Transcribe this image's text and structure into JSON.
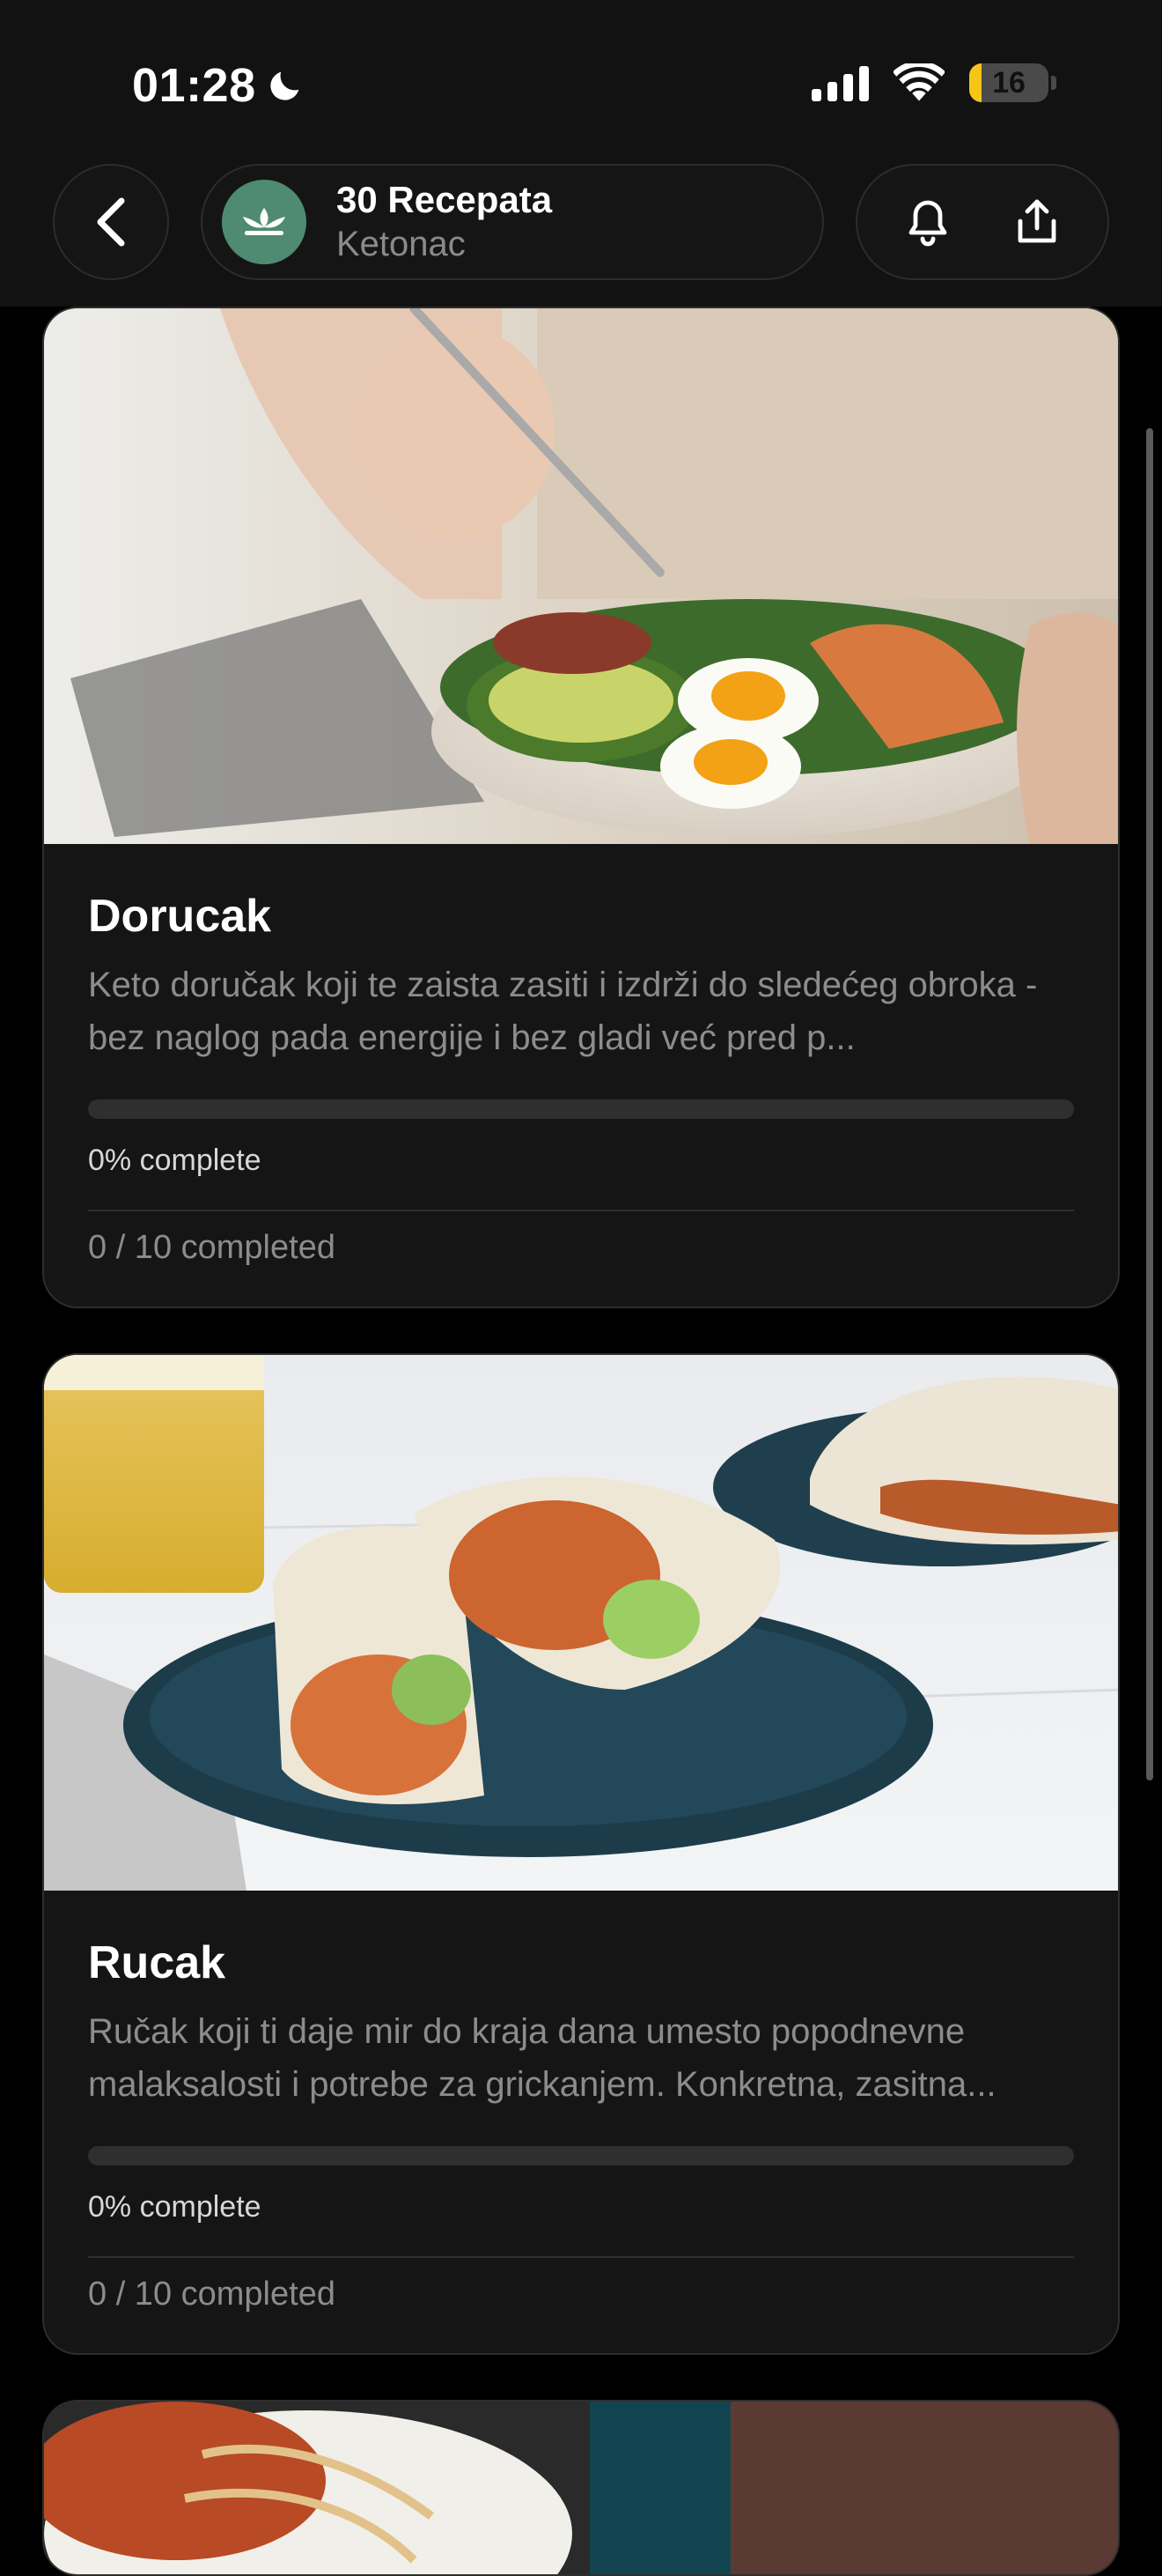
{
  "status_bar": {
    "time": "01:28",
    "battery_level": "16",
    "icons": [
      "moon-icon",
      "signal-icon",
      "wifi-icon",
      "battery-icon"
    ]
  },
  "header": {
    "title": "30 Recepata",
    "subtitle": "Ketonac",
    "back_icon": "chevron-left-icon",
    "avatar_icon": "lotus-icon",
    "actions": [
      "bell-icon",
      "share-icon"
    ],
    "accent_color": "#4f8a73"
  },
  "cards": [
    {
      "title": "Dorucak",
      "description": "Keto doručak koji te zaista zasiti i izdrži do sledećeg obroka - bez naglog pada energije i bez gladi već pred p...",
      "progress_percent": 0,
      "progress_label": "0% complete",
      "completed_label": "0 / 10 completed"
    },
    {
      "title": "Rucak",
      "description": "Ručak koji ti daje mir do kraja dana umesto popodnevne malaksalosti i potrebe za grickanjem. Konkretna, zasitna...",
      "progress_percent": 0,
      "progress_label": "0% complete",
      "completed_label": "0 / 10 completed"
    }
  ]
}
